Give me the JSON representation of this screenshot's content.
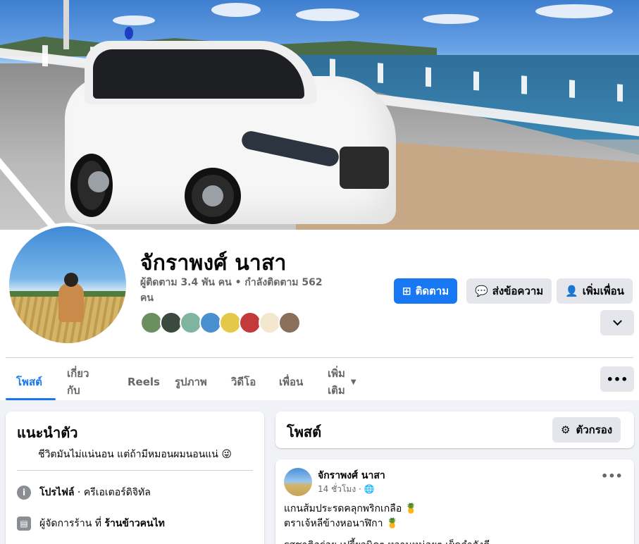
{
  "profile": {
    "name": "จักราพงศ์ นาสา",
    "stats": "ผู้ติดตาม 3.4 พัน คน • กำลังติดตาม 562 คน"
  },
  "actions": {
    "follow": "ติดตาม",
    "message": "ส่งข้อความ",
    "add_friend": "เพิ่มเพื่อน"
  },
  "friends_colors": [
    "#6b8f5e",
    "#3b4a3f",
    "#7fb5a0",
    "#4a8fd0",
    "#e3c84a",
    "#c43a3a",
    "#f4e7d0",
    "#8a6f5a"
  ],
  "tabs": [
    {
      "label": "โพสต์",
      "active": true
    },
    {
      "label": "เกี่ยวกับ"
    },
    {
      "label": "Reels"
    },
    {
      "label": "รูปภาพ"
    },
    {
      "label": "วิดีโอ"
    },
    {
      "label": "เพื่อน"
    },
    {
      "label": "เพิ่มเติม"
    }
  ],
  "intro": {
    "title": "แนะนำตัว",
    "bio": "ชีวิตมันไม่แน่นอน แต่ถ้ามีหมอนผมนอนแน่ 😜",
    "rows": [
      {
        "bold": "โปรไฟล์",
        "text": " · ครีเอเตอร์ดิจิทัล"
      },
      {
        "prefix": "ผู้จัดการร้าน ที่ ",
        "bold": "ร้านข้าวคนไท"
      }
    ]
  },
  "posts_section": {
    "title": "โพสต์",
    "filter_label": "ตัวกรอง"
  },
  "post": {
    "author": "จักราพงศ์ นาสา",
    "time": "14 ชั่วโมง",
    "lines": [
      "แกนส้มประรดคลุกพริกเกลือ 🍍",
      "ตราเจ้หลีข้างหอนาฬิกา 🍍",
      "รสชาติอร่อย เปรี้ยวนิดๆ หวานหน่อยๆ เผ็ดกำลังดี"
    ]
  }
}
